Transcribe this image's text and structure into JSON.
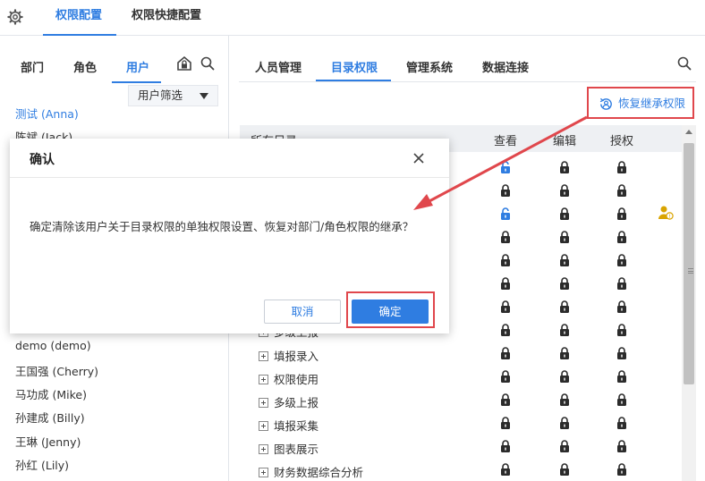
{
  "top_tabs": [
    "权限配置",
    "权限快捷配置"
  ],
  "left_tabs": [
    "部门",
    "角色",
    "用户"
  ],
  "user_filter": "用户筛选",
  "users_top": [
    "测试 (Anna)",
    "陈斌 (Jack)"
  ],
  "users_bottom": [
    "demo (demo)",
    "王国强 (Cherry)",
    "马功成 (Mike)",
    "孙建成 (Billy)",
    "王琳 (Jenny)",
    "孙红 (Lily)"
  ],
  "right_tabs": [
    "人员管理",
    "目录权限",
    "管理系统",
    "数据连接"
  ],
  "restore_label": "恢复继承权限",
  "table_headers": {
    "dir": "所有目录",
    "view": "查看",
    "edit": "编辑",
    "grant": "授权"
  },
  "visible_dirs": [
    {
      "name": "多级上报"
    },
    {
      "name": "填报录入"
    },
    {
      "name": "权限使用"
    },
    {
      "name": "多级上报"
    },
    {
      "name": "填报采集"
    },
    {
      "name": "图表展示"
    },
    {
      "name": "财务数据综合分析"
    }
  ],
  "dialog": {
    "title": "确认",
    "message": "确定清除该用户关于目录权限的单独权限设置、恢复对部门/角色权限的继承？",
    "cancel": "取消",
    "ok": "确定"
  },
  "colors": {
    "accent": "#2f7de1",
    "highlight": "#e0474c",
    "lock": "#2b2b2b",
    "warn": "#d9a400"
  }
}
